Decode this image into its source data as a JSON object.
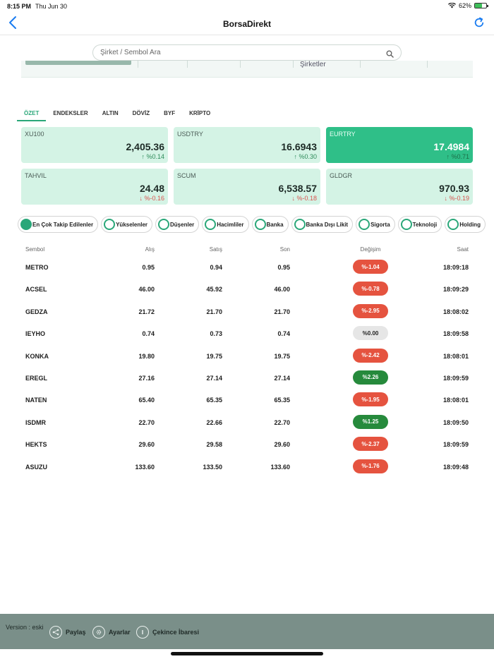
{
  "status_bar": {
    "time": "8:15 PM",
    "date": "Thu Jun 30",
    "battery": "62%",
    "battery_level": 0.62
  },
  "nav": {
    "back_icon": "chevron-left-icon",
    "title": "BorsaDirekt",
    "refresh_icon": "refresh-icon"
  },
  "search": {
    "placeholder": "Şirket / Sembol Ara"
  },
  "banner": {
    "text": "Şirketler"
  },
  "tabs": [
    {
      "label": "ÖZET",
      "active": true
    },
    {
      "label": "ENDEKSLER"
    },
    {
      "label": "ALTIN"
    },
    {
      "label": "DÖVİZ"
    },
    {
      "label": "BYF"
    },
    {
      "label": "KRİPTO"
    }
  ],
  "cards": [
    {
      "name": "XU100",
      "value": "2,405.36",
      "change": "↑ %0.14",
      "dir": "up",
      "highlight": false
    },
    {
      "name": "USDTRY",
      "value": "16.6943",
      "change": "↑ %0.30",
      "dir": "up",
      "highlight": false
    },
    {
      "name": "EURTRY",
      "value": "17.4984",
      "change": "↑ %0.71",
      "dir": "up",
      "highlight": true
    },
    {
      "name": "TAHVIL",
      "value": "24.48",
      "change": "↓ %-0.16",
      "dir": "down",
      "highlight": false
    },
    {
      "name": "SCUM",
      "value": "6,538.57",
      "change": "↓ %-0.18",
      "dir": "down",
      "highlight": false
    },
    {
      "name": "GLDGR",
      "value": "970.93",
      "change": "↓ %-0.19",
      "dir": "down",
      "highlight": false
    }
  ],
  "filters": [
    {
      "label": "En Çok Takip Edilenler",
      "selected": true
    },
    {
      "label": "Yükselenler"
    },
    {
      "label": "Düşenler"
    },
    {
      "label": "Hacimliler"
    },
    {
      "label": "Banka"
    },
    {
      "label": "Banka Dışı Likit"
    },
    {
      "label": "Sigorta"
    },
    {
      "label": "Teknoloji"
    },
    {
      "label": "Holding"
    }
  ],
  "table": {
    "headers": {
      "symbol": "Sembol",
      "bid": "Alış",
      "ask": "Satış",
      "last": "Son",
      "change": "Değişim",
      "time": "Saat"
    },
    "rows": [
      {
        "symbol": "METRO",
        "bid": "0.95",
        "ask": "0.94",
        "last": "0.95",
        "change": "%-1.04",
        "dir": "neg",
        "time": "18:09:18"
      },
      {
        "symbol": "ACSEL",
        "bid": "46.00",
        "ask": "45.92",
        "last": "46.00",
        "change": "%-0.78",
        "dir": "neg",
        "time": "18:09:29"
      },
      {
        "symbol": "GEDZA",
        "bid": "21.72",
        "ask": "21.70",
        "last": "21.70",
        "change": "%-2.95",
        "dir": "neg",
        "time": "18:08:02"
      },
      {
        "symbol": "IEYHO",
        "bid": "0.74",
        "ask": "0.73",
        "last": "0.74",
        "change": "%0.00",
        "dir": "zero",
        "time": "18:09:58"
      },
      {
        "symbol": "KONKA",
        "bid": "19.80",
        "ask": "19.75",
        "last": "19.75",
        "change": "%-2.42",
        "dir": "neg",
        "time": "18:08:01"
      },
      {
        "symbol": "EREGL",
        "bid": "27.16",
        "ask": "27.14",
        "last": "27.14",
        "change": "%2.26",
        "dir": "pos",
        "time": "18:09:59"
      },
      {
        "symbol": "NATEN",
        "bid": "65.40",
        "ask": "65.35",
        "last": "65.35",
        "change": "%-1.95",
        "dir": "neg",
        "time": "18:08:01"
      },
      {
        "symbol": "ISDMR",
        "bid": "22.70",
        "ask": "22.66",
        "last": "22.70",
        "change": "%1.25",
        "dir": "pos",
        "time": "18:09:50"
      },
      {
        "symbol": "HEKTS",
        "bid": "29.60",
        "ask": "29.58",
        "last": "29.60",
        "change": "%-2.37",
        "dir": "neg",
        "time": "18:09:59"
      },
      {
        "symbol": "ASUZU",
        "bid": "133.60",
        "ask": "133.50",
        "last": "133.60",
        "change": "%-1.76",
        "dir": "neg",
        "time": "18:09:48"
      }
    ]
  },
  "footer": {
    "version": "Version : eski",
    "share": {
      "label": "Paylaş",
      "icon": "share-icon"
    },
    "settings": {
      "label": "Ayarlar",
      "icon": "gear-icon"
    },
    "disclaimer": {
      "label": "Çekince İbaresi",
      "icon": "info-icon"
    }
  },
  "colors": {
    "accent": "#2aa779",
    "card_bg": "#d4f3e5",
    "card_highlight": "#2fbf88",
    "negative": "#e5533f",
    "positive": "#268a3c",
    "footer_bg": "#7a8f89",
    "link": "#1a7cf0"
  }
}
